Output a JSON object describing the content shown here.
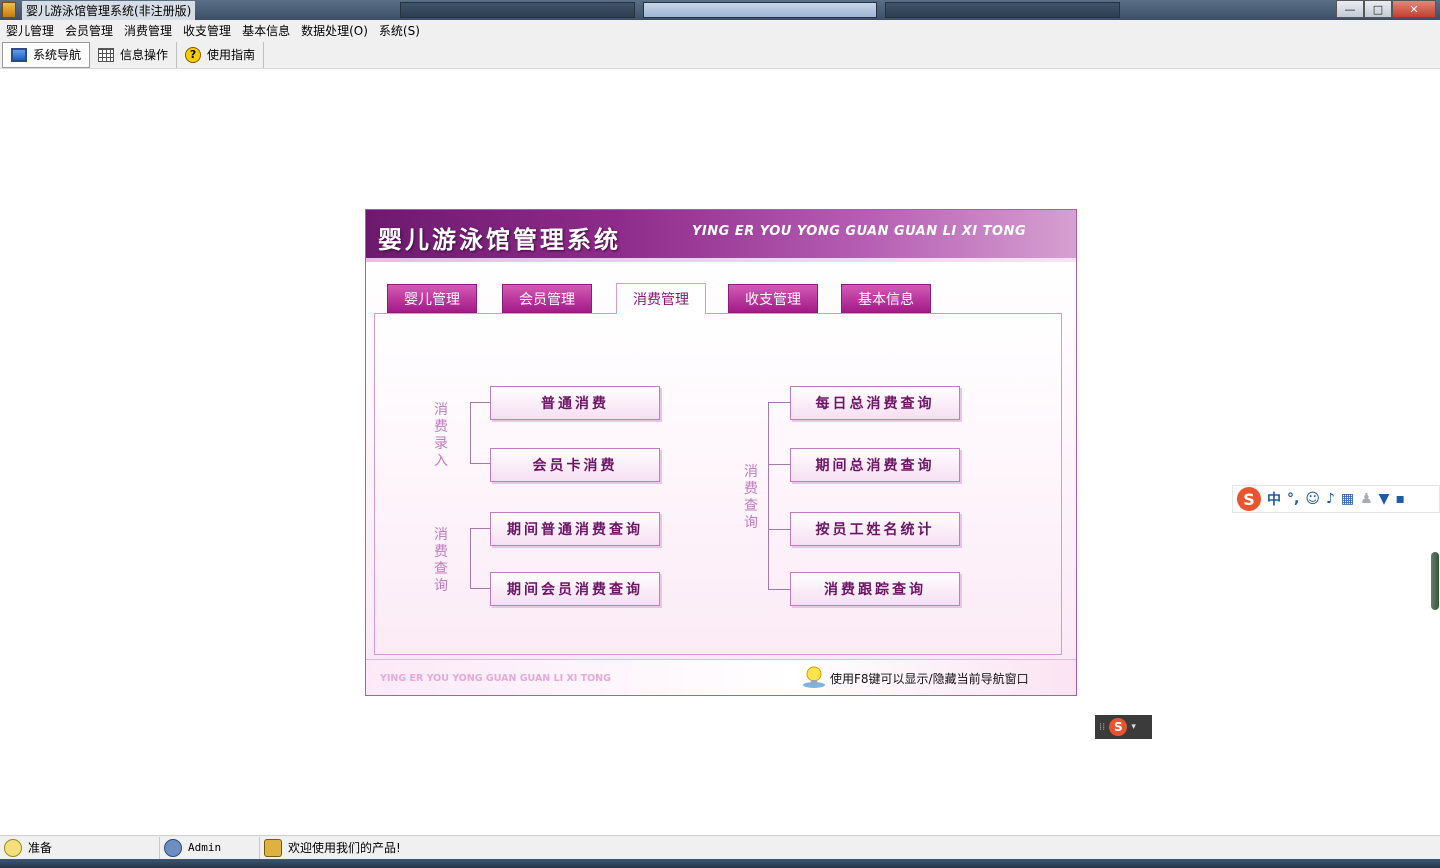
{
  "window": {
    "title": "婴儿游泳馆管理系统(非注册版)",
    "controls": {
      "minimize": "—",
      "maximize": "□",
      "close": "✕"
    }
  },
  "menubar": {
    "items": [
      "婴儿管理",
      "会员管理",
      "消费管理",
      "收支管理",
      "基本信息",
      "数据处理(O)",
      "系统(S)"
    ]
  },
  "toolbar": {
    "items": [
      {
        "label": "系统导航",
        "icon": "monitor-icon"
      },
      {
        "label": "信息操作",
        "icon": "grid-icon"
      },
      {
        "label": "使用指南",
        "icon": "help-icon"
      }
    ]
  },
  "nav_panel": {
    "title": "婴儿游泳馆管理系统",
    "subtitle": "YING ER YOU YONG GUAN GUAN LI XI TONG",
    "tabs": [
      "婴儿管理",
      "会员管理",
      "消费管理",
      "收支管理",
      "基本信息"
    ],
    "active_tab": "消费管理",
    "groups": {
      "entry": {
        "label": "消费录入",
        "buttons": [
          "普通消费",
          "会员卡消费"
        ]
      },
      "period": {
        "label": "消费查询",
        "buttons": [
          "期间普通消费查询",
          "期间会员消费查询"
        ]
      },
      "query": {
        "label": "消费查询",
        "buttons": [
          "每日总消费查询",
          "期间总消费查询",
          "按员工姓名统计",
          "消费跟踪查询"
        ]
      }
    },
    "footer": {
      "english": "YING ER YOU YONG GUAN GUAN LI XI TONG",
      "hint": "使用F8键可以显示/隐藏当前导航窗口"
    }
  },
  "ime": {
    "logo": "S",
    "mode": "中"
  },
  "statusbar": {
    "status": "准备",
    "user": "Admin",
    "message": "欢迎使用我们的产品!"
  },
  "colors": {
    "header_dark": "#6c1a6e",
    "tab": "#a31a88",
    "button_text": "#6c1466",
    "group_label": "#c27cc0"
  }
}
